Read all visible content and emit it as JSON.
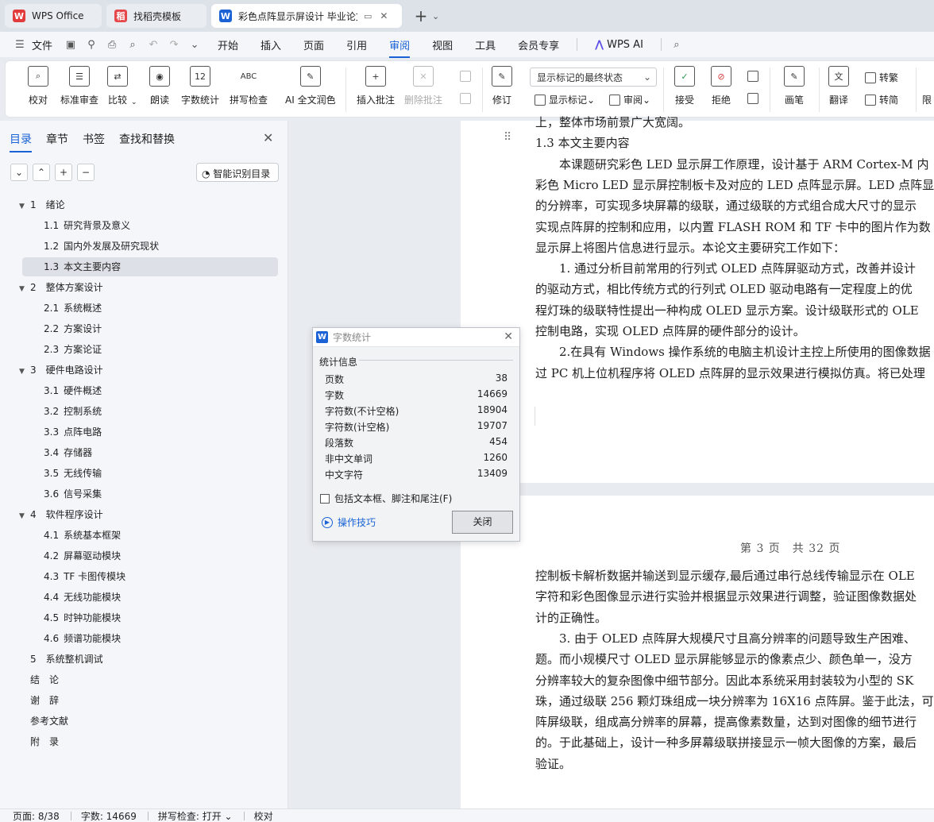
{
  "tabs": [
    {
      "label": "WPS Office",
      "icon": "wps-logo-icon",
      "color": "#e23b3b",
      "glyph": "W"
    },
    {
      "label": "找稻壳模板",
      "icon": "docer-logo-icon",
      "color": "#e6474a",
      "glyph": "稻"
    },
    {
      "label": "彩色点阵显示屏设计 毕业论文",
      "icon": "word-doc-icon",
      "color": "#1a62d6",
      "glyph": "W"
    }
  ],
  "menu": {
    "file": "文件",
    "tabs": [
      "开始",
      "插入",
      "页面",
      "引用",
      "审阅",
      "视图",
      "工具",
      "会员专享"
    ],
    "active_tab": "审阅",
    "ai": "WPS AI"
  },
  "ribbon": {
    "proofread": "校对",
    "standard_review": "标准审查",
    "compare": "比较",
    "read_aloud": "朗读",
    "word_count": "字数统计",
    "spell_check": "拼写检查",
    "ai_polish": "AI 全文润色",
    "insert_comment": "插入批注",
    "delete_comment": "删除批注",
    "revise": "修订",
    "markup_dropdown": "显示标记的最终状态",
    "show_markup": "显示标记",
    "review": "审阅",
    "accept": "接受",
    "reject": "拒绝",
    "pen": "画笔",
    "translate": "翻译",
    "to_traditional": "转繁",
    "to_simplified": "转简",
    "limit": "限"
  },
  "nav": {
    "tabs": [
      "目录",
      "章节",
      "书签",
      "查找和替换"
    ],
    "active": "目录",
    "smart_btn": "智能识别目录",
    "toc": [
      {
        "num": "1",
        "label": "绪论",
        "level": 1,
        "expand": true
      },
      {
        "num": "1.1",
        "label": "研究背景及意义",
        "level": 2
      },
      {
        "num": "1.2",
        "label": "国内外发展及研究现状",
        "level": 2
      },
      {
        "num": "1.3",
        "label": "本文主要内容",
        "level": 2,
        "selected": true
      },
      {
        "num": "2",
        "label": "整体方案设计",
        "level": 1,
        "expand": true
      },
      {
        "num": "2.1",
        "label": "系统概述",
        "level": 2
      },
      {
        "num": "2.2",
        "label": "方案设计",
        "level": 2
      },
      {
        "num": "2.3",
        "label": "方案论证",
        "level": 2
      },
      {
        "num": "3",
        "label": "硬件电路设计",
        "level": 1,
        "expand": true
      },
      {
        "num": "3.1",
        "label": "硬件概述",
        "level": 2
      },
      {
        "num": "3.2",
        "label": "控制系统",
        "level": 2
      },
      {
        "num": "3.3",
        "label": "点阵电路",
        "level": 2
      },
      {
        "num": "3.4",
        "label": "存储器",
        "level": 2
      },
      {
        "num": "3.5",
        "label": "无线传输",
        "level": 2
      },
      {
        "num": "3.6",
        "label": "信号采集",
        "level": 2
      },
      {
        "num": "4",
        "label": "软件程序设计",
        "level": 1,
        "expand": true
      },
      {
        "num": "4.1",
        "label": "系统基本框架",
        "level": 2
      },
      {
        "num": "4.2",
        "label": "屏幕驱动模块",
        "level": 2
      },
      {
        "num": "4.3",
        "label": "TF 卡图传模块",
        "level": 2
      },
      {
        "num": "4.4",
        "label": "无线功能模块",
        "level": 2
      },
      {
        "num": "4.5",
        "label": "时钟功能模块",
        "level": 2
      },
      {
        "num": "4.6",
        "label": "频谱功能模块",
        "level": 2
      },
      {
        "num": "5",
        "label": "系统整机调试",
        "level": 1
      },
      {
        "num": "",
        "label": "结　论",
        "level": 1
      },
      {
        "num": "",
        "label": "谢　辞",
        "level": 1
      },
      {
        "num": "",
        "label": "参考文献",
        "level": 1
      },
      {
        "num": "",
        "label": "附　录",
        "level": 1
      }
    ]
  },
  "doc": {
    "page1_lines": [
      "上，整体市场前景广大宽阔。",
      "1.3  本文主要内容",
      "　　本课题研究彩色 LED 显示屏工作原理，设计基于 ARM Cortex-M 内",
      "彩色 Micro LED 显示屏控制板卡及对应的 LED 点阵显示屏。LED 点阵显",
      "的分辨率，可实现多块屏幕的级联，通过级联的方式组合成大尺寸的显示",
      "实现点阵屏的控制和应用，以内置 FLASH ROM 和 TF 卡中的图片作为数",
      "显示屏上将图片信息进行显示。本论文主要研究工作如下：",
      "　　1. 通过分析目前常用的行列式 OLED 点阵屏驱动方式，改善并设计",
      "的驱动方式，相比传统方式的行列式 OLED 驱动电路有一定程度上的优",
      "程灯珠的级联特性提出一种构成 OLED 显示方案。设计级联形式的 OLE",
      "控制电路，实现 OLED 点阵屏的硬件部分的设计。",
      "　　2.在具有 Windows 操作系统的电脑主机设计主控上所使用的图像数据",
      "过 PC 机上位机程序将 OLED 点阵屏的显示效果进行模拟仿真。将已处理"
    ],
    "footer": "第 3 页　共 32 页",
    "page2_lines": [
      "控制板卡解析数据并输送到显示缓存,最后通过串行总线传输显示在 OLE",
      "字符和彩色图像显示进行实验并根据显示效果进行调整，验证图像数据处",
      "计的正确性。",
      "　　3. 由于 OLED 点阵屏大规模尺寸且高分辨率的问题导致生产困难、",
      "题。而小规模尺寸 OLED 显示屏能够显示的像素点少、颜色单一，没方",
      "分辨率较大的复杂图像中细节部分。因此本系统采用封装较为小型的 SK",
      "珠，通过级联 256 颗灯珠组成一块分辨率为 16X16 点阵屏。鉴于此法，可",
      "阵屏级联，组成高分辨率的屏幕，提高像素数量，达到对图像的细节进行",
      "的。于此基础上，设计一种多屏幕级联拼接显示一帧大图像的方案，最后",
      "验证。"
    ]
  },
  "dialog": {
    "title": "字数统计",
    "section": "统计信息",
    "rows": [
      {
        "label": "页数",
        "value": "38"
      },
      {
        "label": "字数",
        "value": "14669"
      },
      {
        "label": "字符数(不计空格)",
        "value": "18904"
      },
      {
        "label": "字符数(计空格)",
        "value": "19707"
      },
      {
        "label": "段落数",
        "value": "454"
      },
      {
        "label": "非中文单词",
        "value": "1260"
      },
      {
        "label": "中文字符",
        "value": "13409"
      }
    ],
    "checkbox": "包括文本框、脚注和尾注(F)",
    "tips": "操作技巧",
    "close": "关闭"
  },
  "status": {
    "page": "页面: 8/38",
    "words": "字数: 14669",
    "spell": "拼写检查: 打开",
    "proof": "校对"
  }
}
